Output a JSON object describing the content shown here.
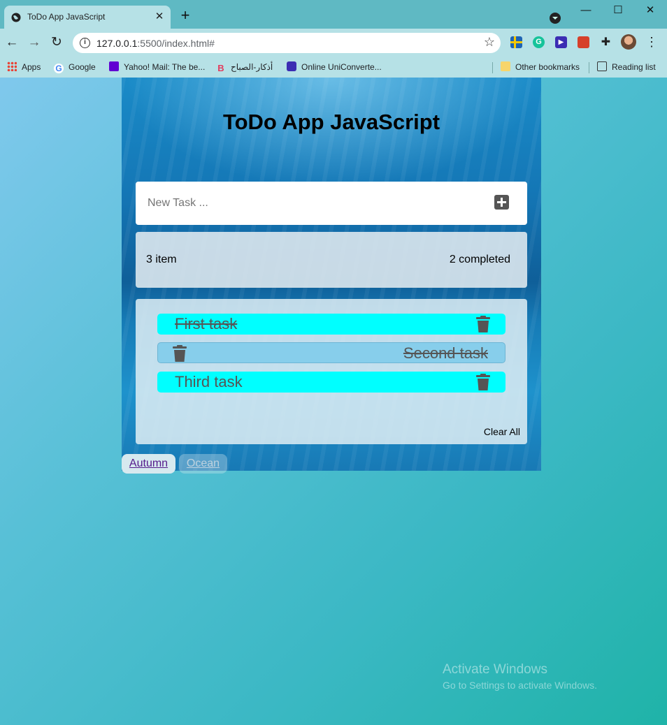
{
  "browser": {
    "tab_title": "ToDo App JavaScript",
    "tab_close": "✕",
    "new_tab": "+",
    "url_host": "127.0.0.1",
    "url_rest": ":5500/index.html#",
    "win_min": "—",
    "win_max": "☐",
    "win_close": "✕",
    "bookmarks": {
      "apps": "Apps",
      "google": "Google",
      "yahoo": "Yahoo! Mail: The be...",
      "adhkar": "أذكار-الصباح",
      "uniconverter": "Online UniConverte...",
      "other": "Other bookmarks",
      "reading": "Reading list"
    }
  },
  "app": {
    "title": "ToDo App JavaScript",
    "input_placeholder": "New Task ...",
    "items_count": "3 item",
    "completed_count": "2 completed",
    "tasks": [
      {
        "text": "First task",
        "completed": true
      },
      {
        "text": "Second task",
        "completed": true
      },
      {
        "text": "Third task",
        "completed": false
      }
    ],
    "clear_all": "Clear All",
    "themes": {
      "autumn": "Autumn",
      "ocean": "Ocean"
    }
  },
  "watermark": {
    "title": "Activate Windows",
    "subtitle": "Go to Settings to activate Windows."
  },
  "colors": {
    "task_cyan": "#00ffff",
    "task_blue": "#87ceeb",
    "icon_gray": "#555555"
  }
}
